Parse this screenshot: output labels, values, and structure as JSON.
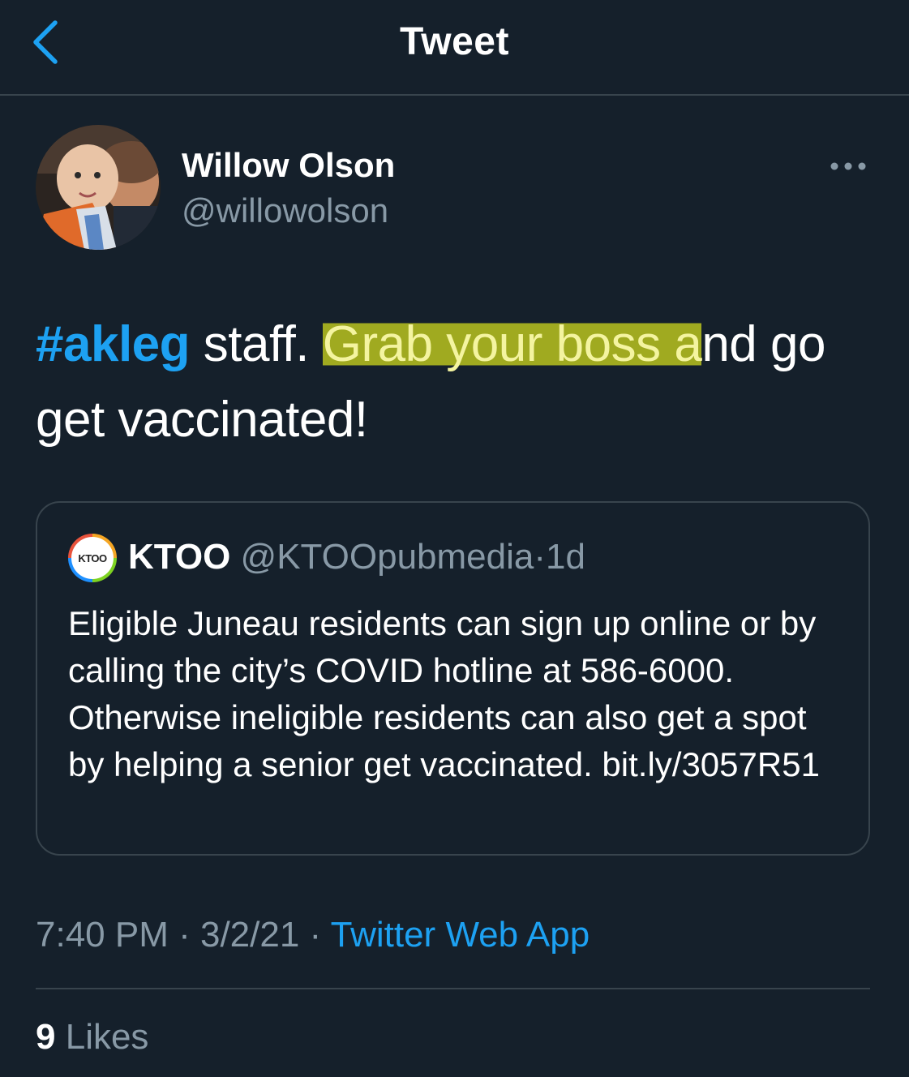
{
  "header": {
    "title": "Tweet",
    "back_icon": "chevron-left-icon"
  },
  "author": {
    "name": "Willow Olson",
    "handle": "@willowolson"
  },
  "tweet": {
    "hashtag": "#akleg",
    "text_part1": " staff. ",
    "text_highlight_a": "Grab your boss a",
    "text_part2": "nd go get vaccinated!"
  },
  "quoted_tweet": {
    "avatar_text": "KTOO",
    "name": "KTOO",
    "handle": "@KTOOpubmedia",
    "separator": "·",
    "time": "1d",
    "text": "Eligible Juneau residents can sign up online or by calling the city’s COVID hotline at 586-6000. Otherwise ineligible residents can also get a spot by helping a senior get vaccinated. bit.ly/3057R51"
  },
  "meta": {
    "time": "7:40 PM",
    "sep1": " · ",
    "date": "3/2/21",
    "sep2": " · ",
    "source": "Twitter Web App"
  },
  "likes": {
    "count": "9",
    "label": "Likes"
  },
  "colors": {
    "background": "#15202b",
    "accent": "#1da1f2",
    "secondary_text": "#8899a6",
    "divider": "#38444d",
    "highlight": "#bec81e"
  }
}
